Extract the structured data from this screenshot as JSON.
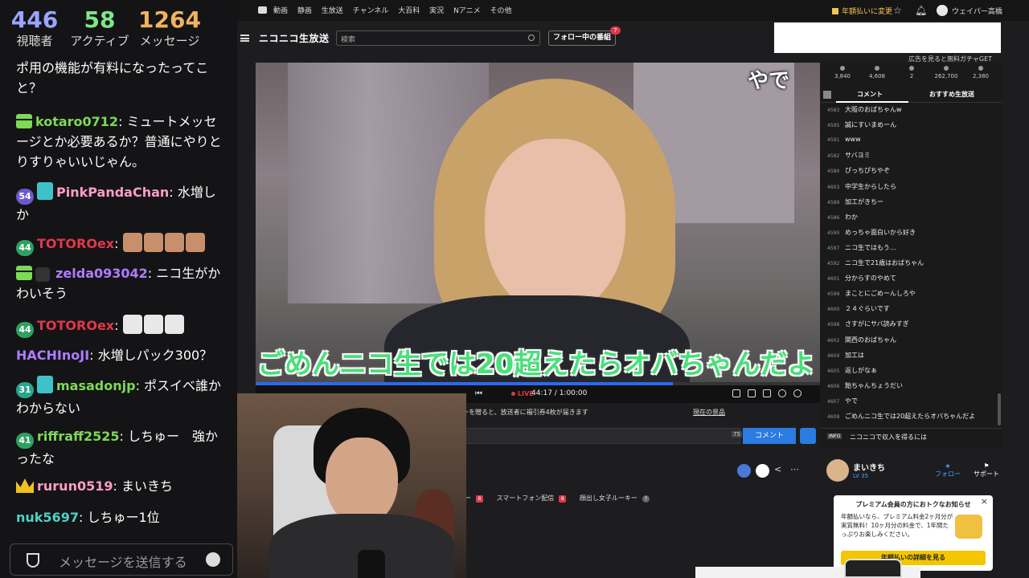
{
  "chat_overlay": {
    "stats": [
      {
        "value": "446",
        "label": "視聴者"
      },
      {
        "value": "58",
        "label": "アクティブ"
      },
      {
        "value": "1264",
        "label": "メッセージ"
      }
    ],
    "messages": [
      {
        "user": "",
        "text": "ポ用の機能が有料になったってこと？"
      },
      {
        "user": "kotaro0712",
        "user_color": "#7ed957",
        "text": "ミュートメッセージとか必要あるか？普通にやりとりすりゃいいじゃん。"
      },
      {
        "user": "PinkPandaChan",
        "user_color": "#ff9cc8",
        "badge": "54",
        "text": "水増しか"
      },
      {
        "user": "TOTOROex",
        "user_color": "#e0384a",
        "badge": "44",
        "text": ""
      },
      {
        "user": "zelda093042",
        "user_color": "#b07cff",
        "text": "ニコ生がかわいそう"
      },
      {
        "user": "TOTOROex",
        "user_color": "#e0384a",
        "badge": "44",
        "text": ""
      },
      {
        "user": "HACHInoJI",
        "user_color": "#b07cff",
        "text": "水増しパック300？"
      },
      {
        "user": "masadonjp",
        "user_color": "#7ed957",
        "badge": "31",
        "text": "ポスイベ誰かわからない"
      },
      {
        "user": "riffraff2525",
        "user_color": "#7ed957",
        "badge": "41",
        "text": "しちゅー　強かったな"
      },
      {
        "user": "rurun0519",
        "user_color": "#ff9cc8",
        "text": "まいきち"
      },
      {
        "user": "nuk5697",
        "user_color": "#4fd1c5",
        "text": "しちゅー1位"
      }
    ],
    "input_placeholder": "メッセージを送信する"
  },
  "topnav": {
    "items": [
      "動画",
      "静画",
      "生放送",
      "チャンネル",
      "大百科",
      "実況",
      "Nアニメ",
      "その他"
    ],
    "premium_link": "年額払いに変更",
    "user_name": "ウェイパー高橋"
  },
  "header": {
    "logo": "ニコニコ生放送",
    "search_placeholder": "検索",
    "follow_button": "フォロー中の番組",
    "follow_badge": "7",
    "ad_note": "広告を見ると無料ガチャGET"
  },
  "video": {
    "overlay_text": "やで",
    "subtitle": "ごめんニコ生では20超えたらオバちゃんだよ",
    "live_label": "LIVE",
    "time": "44:17 / 1:00:00",
    "progress": 0.737
  },
  "below_video": {
    "info_text": "ーを贈ると、放送者に福引券4枚が届きます",
    "info_link": "現在の景品",
    "comment_count": "75",
    "comment_button": "コメント"
  },
  "panel": {
    "stats": [
      "3,840",
      "4,608",
      "2",
      "262,700",
      "2,380"
    ],
    "tabs": [
      "コメント",
      "おすすめ生放送"
    ],
    "comments": [
      {
        "no": "4583",
        "text": "大阪のおばちゃんw"
      },
      {
        "no": "4595",
        "text": "誠にすいまめーん"
      },
      {
        "no": "4591",
        "text": "www"
      },
      {
        "no": "4582",
        "text": "サバヨミ"
      },
      {
        "no": "4580",
        "text": "ぴっちぴちやぞ"
      },
      {
        "no": "4603",
        "text": "中学生からしたら"
      },
      {
        "no": "4589",
        "text": "加工がきちー"
      },
      {
        "no": "4586",
        "text": "わか"
      },
      {
        "no": "4590",
        "text": "めっちゃ面白いから好き"
      },
      {
        "no": "4597",
        "text": "ニコ生ではもう…"
      },
      {
        "no": "4592",
        "text": "ニコ生で21歳はおばちゃん"
      },
      {
        "no": "4601",
        "text": "分からすのやめて"
      },
      {
        "no": "4599",
        "text": "まことにごめーんしろや"
      },
      {
        "no": "4600",
        "text": "２４ぐらいです"
      },
      {
        "no": "4598",
        "text": "さすがにサバ読みすぎ"
      },
      {
        "no": "4602",
        "text": "関西のおばちゃん"
      },
      {
        "no": "4604",
        "text": "加工は"
      },
      {
        "no": "4605",
        "text": "返しがなぁ"
      },
      {
        "no": "4606",
        "text": "飴ちゃんちょうだい"
      },
      {
        "no": "4607",
        "text": "やで"
      },
      {
        "no": "4608",
        "text": "ごめんニコ生では20超えたらオバちゃんだよ"
      }
    ],
    "info_tag": "INFO",
    "info_text": "ニコニコで収入を得るには"
  },
  "streamer": {
    "name": "まいきち",
    "level": "LV 35",
    "follow": "フォロー",
    "report": "サポート"
  },
  "tags": [
    "ー",
    "スマートフォン配信",
    "顔出し女子ルーキー"
  ],
  "popup": {
    "title": "プレミアム会員の方におトクなお知らせ",
    "body": "年額払いなら、プレミアム料金2ヶ月分が実質無料！10ヶ月分の料金で、1年間たっぷりお楽しみください。",
    "button": "年額払いの詳細を見る"
  }
}
